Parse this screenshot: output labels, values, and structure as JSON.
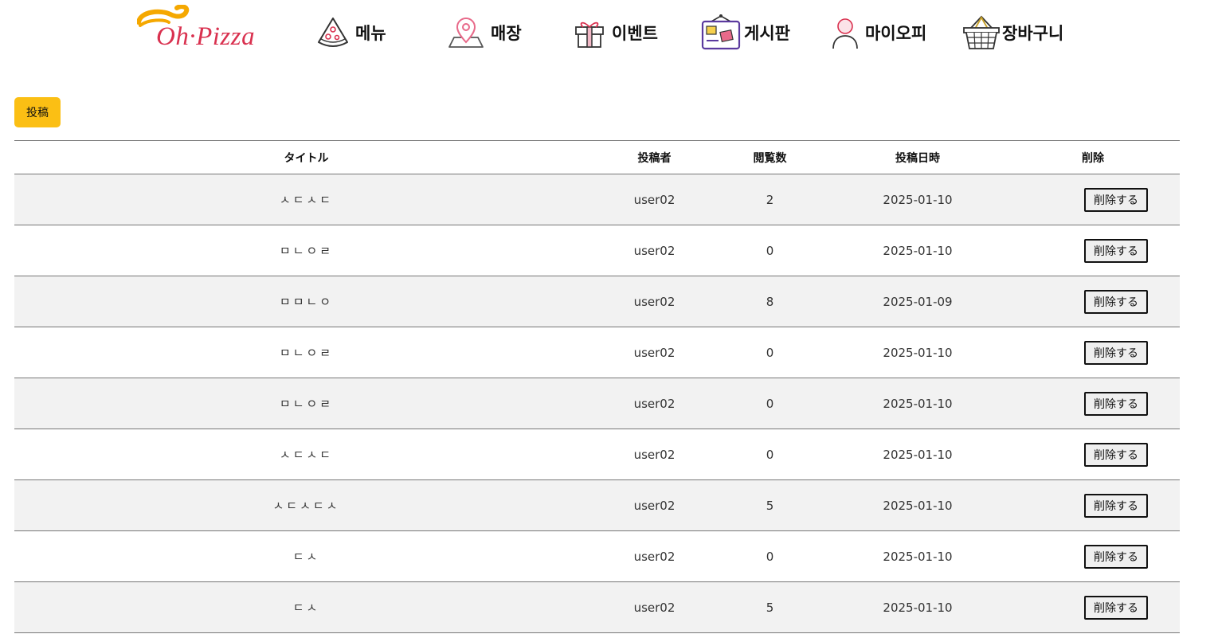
{
  "brand": {
    "logo_text": "Oh·Pizza",
    "color": "#d9314f",
    "swirl_color": "#f5a800"
  },
  "nav": {
    "items": [
      {
        "label": "메뉴",
        "icon": "pizza-slice-icon"
      },
      {
        "label": "매장",
        "icon": "map-pin-icon"
      },
      {
        "label": "이벤트",
        "icon": "gift-icon"
      },
      {
        "label": "게시판",
        "icon": "bulletin-board-icon"
      },
      {
        "label": "마이오피",
        "icon": "user-icon"
      },
      {
        "label": "장바구니",
        "icon": "basket-icon"
      }
    ]
  },
  "toolbar": {
    "post_label": "投稿",
    "post_color": "#fbbf14"
  },
  "table": {
    "headers": {
      "title": "タイトル",
      "author": "投稿者",
      "views": "閲覧数",
      "date": "投稿日時",
      "delete": "削除"
    },
    "delete_label": "削除する",
    "rows": [
      {
        "title": "ㅅㄷㅅㄷ",
        "author": "user02",
        "views": "2",
        "date": "2025-01-10"
      },
      {
        "title": "ㅁㄴㅇㄹ",
        "author": "user02",
        "views": "0",
        "date": "2025-01-10"
      },
      {
        "title": "ㅁㅁㄴㅇ",
        "author": "user02",
        "views": "8",
        "date": "2025-01-09"
      },
      {
        "title": "ㅁㄴㅇㄹ",
        "author": "user02",
        "views": "0",
        "date": "2025-01-10"
      },
      {
        "title": "ㅁㄴㅇㄹ",
        "author": "user02",
        "views": "0",
        "date": "2025-01-10"
      },
      {
        "title": "ㅅㄷㅅㄷ",
        "author": "user02",
        "views": "0",
        "date": "2025-01-10"
      },
      {
        "title": "ㅅㄷㅅㄷㅅ",
        "author": "user02",
        "views": "5",
        "date": "2025-01-10"
      },
      {
        "title": "ㄷㅅ",
        "author": "user02",
        "views": "0",
        "date": "2025-01-10"
      },
      {
        "title": "ㄷㅅ",
        "author": "user02",
        "views": "5",
        "date": "2025-01-10"
      }
    ]
  }
}
